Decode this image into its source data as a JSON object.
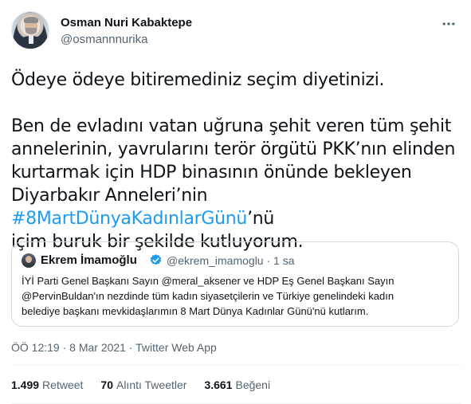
{
  "author": {
    "display_name": "Osman Nuri Kabaktepe",
    "handle": "@osmannnurika",
    "avatar": "avatar-photo"
  },
  "tweet": {
    "paragraph_1": "Ödeye ödeye bitiremediniz seçim diyetinizi.",
    "paragraph_2_lines": [
      "Ben de evladını vatan uğruna şehit veren tüm şehit",
      "annelerinin, yavrularını terör örgütü PKK’nın elinden",
      "kurtarmak için HDP binasının önünde bekleyen"
    ],
    "line_prefix": "Diyarbakır Anneleri’nin ",
    "hashtag": "#8MartDünyaKadınlarGünü",
    "line_suffix": "’nü",
    "last_line": "içim buruk bir şekilde kutluyorum."
  },
  "quoted_tweet": {
    "display_name": "Ekrem İmamoğlu",
    "verified_icon": "verified-badge-icon",
    "handle": "@ekrem_imamoglu",
    "separator": "·",
    "time": "1 sa",
    "text_lines": [
      "İYİ Parti Genel Başkanı Sayın @meral_aksener ve HDP Eş Genel Başkanı Sayın",
      "@PervinBuldan'ın nezdinde tüm kadın siyasetçilerin ve Türkiye genelindeki kadın",
      "belediye başkanı mevkidaşlarımın 8 Mart Dünya Kadınlar Günü'nü kutlarım."
    ]
  },
  "timestamp": "ÖÖ 12:19 · 8 Mar 2021 · Twitter Web App",
  "stats": {
    "retweets_count": "1.499",
    "retweets_label": "Retweet",
    "quotes_count": "70",
    "quotes_label": "Alıntı Tweetler",
    "likes_count": "3.661",
    "likes_label": "Beğeni"
  },
  "colors": {
    "link": "#1d9bf0",
    "secondary_text": "#536471",
    "primary_text": "#0f1419",
    "border": "#cfd9de"
  }
}
